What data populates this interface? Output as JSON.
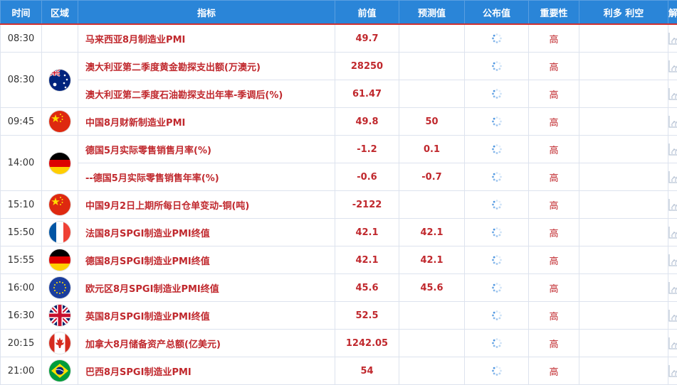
{
  "header": {
    "time": "时间",
    "region": "区域",
    "indicator": "指标",
    "previous": "前值",
    "forecast": "预测值",
    "actual": "公布值",
    "importance": "重要性",
    "effect": "利多 利空",
    "analysis": "解读"
  },
  "rows": [
    {
      "time": "08:30",
      "flag": "",
      "indicator": "马来西亚8月制造业PMI",
      "previous": "49.7",
      "forecast": "",
      "importance": "高"
    },
    {
      "time": "08:30",
      "flag": "australia-flag-icon",
      "indicator": "澳大利亚第二季度黄金勘探支出额(万澳元)",
      "previous": "28250",
      "forecast": "",
      "importance": "高"
    },
    {
      "time": "",
      "flag": "",
      "indicator": "澳大利亚第二季度石油勘探支出年率-季调后(%)",
      "previous": "61.47",
      "forecast": "",
      "importance": "高"
    },
    {
      "time": "09:45",
      "flag": "china-flag-icon",
      "indicator": "中国8月财新制造业PMI",
      "previous": "49.8",
      "forecast": "50",
      "importance": "高"
    },
    {
      "time": "14:00",
      "flag": "germany-flag-icon",
      "indicator": "德国5月实际零售销售月率(%)",
      "previous": "-1.2",
      "forecast": "0.1",
      "importance": "高"
    },
    {
      "time": "",
      "flag": "",
      "indicator": "--德国5月实际零售销售年率(%)",
      "previous": "-0.6",
      "forecast": "-0.7",
      "importance": "高"
    },
    {
      "time": "15:10",
      "flag": "china-flag-icon",
      "indicator": "中国9月2日上期所每日仓单变动-铜(吨)",
      "previous": "-2122",
      "forecast": "",
      "importance": "高"
    },
    {
      "time": "15:50",
      "flag": "france-flag-icon",
      "indicator": "法国8月SPGI制造业PMI终值",
      "previous": "42.1",
      "forecast": "42.1",
      "importance": "高"
    },
    {
      "time": "15:55",
      "flag": "germany-flag-icon",
      "indicator": "德国8月SPGI制造业PMI终值",
      "previous": "42.1",
      "forecast": "42.1",
      "importance": "高"
    },
    {
      "time": "16:00",
      "flag": "eu-flag-icon",
      "indicator": "欧元区8月SPGI制造业PMI终值",
      "previous": "45.6",
      "forecast": "45.6",
      "importance": "高"
    },
    {
      "time": "16:30",
      "flag": "uk-flag-icon",
      "indicator": "英国8月SPGI制造业PMI终值",
      "previous": "52.5",
      "forecast": "",
      "importance": "高"
    },
    {
      "time": "20:15",
      "flag": "canada-flag-icon",
      "indicator": "加拿大8月储备资产总额(亿美元)",
      "previous": "1242.05",
      "forecast": "",
      "importance": "高"
    },
    {
      "time": "21:00",
      "flag": "brazil-flag-icon",
      "indicator": "巴西8月SPGI制造业PMI",
      "previous": "54",
      "forecast": "",
      "importance": "高"
    }
  ],
  "colors": {
    "header_bg": "#2a85d8",
    "header_underline": "#cf2f2f",
    "indicator_text": "#c0282d",
    "border": "#dde3ee"
  }
}
